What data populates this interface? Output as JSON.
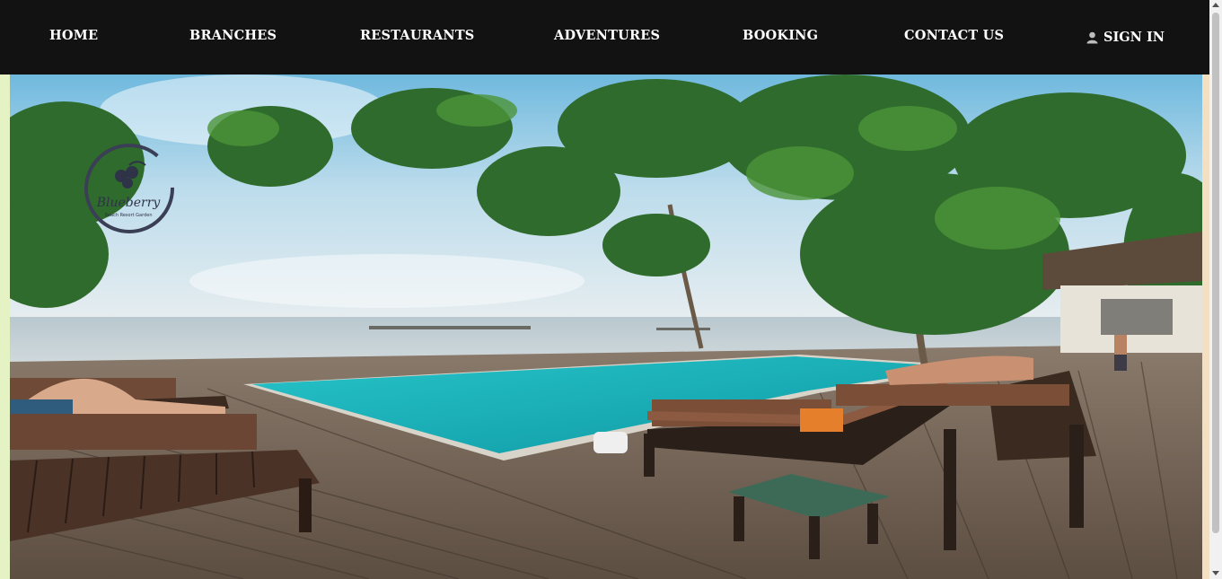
{
  "nav": {
    "items": [
      {
        "label": "HOME"
      },
      {
        "label": "BRANCHES"
      },
      {
        "label": "RESTAURANTS"
      },
      {
        "label": "ADVENTURES"
      },
      {
        "label": "BOOKING"
      },
      {
        "label": "CONTACT US"
      }
    ],
    "sign_in": {
      "label": "SIGN IN",
      "icon": "user-icon"
    }
  },
  "logo": {
    "name": "Blueberry",
    "tagline": "Beach Resort Garden"
  },
  "colors": {
    "navbar_bg": "#121212",
    "nav_text": "#ffffff",
    "pool": "#1fb5bb",
    "left_strip": "#e5f3c4",
    "right_strip": "#f3dfc1"
  }
}
